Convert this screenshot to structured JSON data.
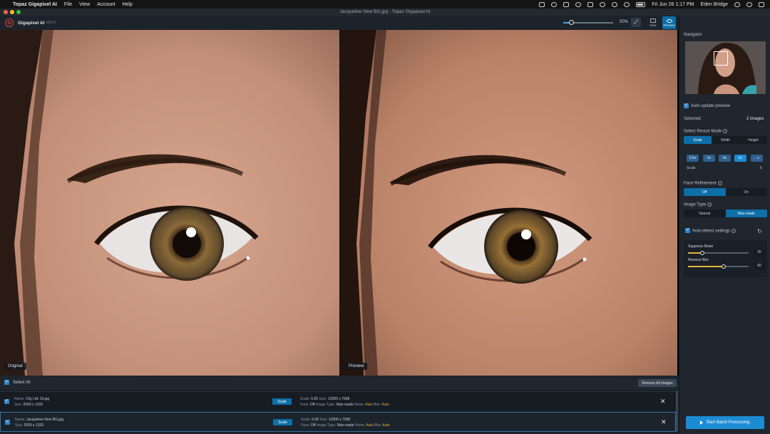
{
  "menubar": {
    "app": "Topaz Gigapixel AI",
    "items": [
      "File",
      "View",
      "Account",
      "Help"
    ],
    "datetime": "Fri Jun 26  1:17 PM",
    "user": "Eden Bridge"
  },
  "window": {
    "title": "Jacqueline New BG.jpg - Topaz Gigapixel AI"
  },
  "toolbar": {
    "app_name": "Gigapixel AI",
    "version": "v5.0.0",
    "zoom": "50%",
    "view_label": "View",
    "preview_label": "Preview"
  },
  "panes": {
    "original_label": "Original",
    "preview_label": "Preview"
  },
  "sidebar": {
    "navigator": "Navigator",
    "auto_update": "Auto-update preview",
    "selected_label": "Selected:",
    "selected_value": "2 images",
    "resize_mode_title": "Select Resize Mode",
    "resize_modes": [
      "Scale",
      "Width",
      "Height"
    ],
    "scale_options": [
      "0.5x",
      "2x",
      "4x",
      "6x",
      "...x"
    ],
    "scale_label": "Scale",
    "scale_value": "6",
    "face_title": "Face Refinement",
    "face_options": [
      "Off",
      "On"
    ],
    "image_type_title": "Image Type",
    "image_type_options": [
      "Natural",
      "Man-made"
    ],
    "auto_detect": "Auto-detect settings",
    "suppress_noise_label": "Suppress Noise",
    "suppress_noise_value": "20",
    "remove_blur_label": "Remove Blur",
    "remove_blur_value": "60",
    "batch_button": "Start Batch Processing"
  },
  "filelist": {
    "select_all": "Select All",
    "remove_all": "Remove All Images",
    "files": [
      {
        "name_label": "Name:",
        "name": "City Life 19.jpg",
        "size_label": "Size:",
        "size": "2000 x 1333",
        "scale_btn": "Scale",
        "scale_label": "Scale:",
        "scale": "6.00",
        "outsize_label": "Size:",
        "outsize": "12000 x 7998",
        "face_label": "Face:",
        "face": "Off",
        "type_label": "Image Type:",
        "type": "Man-made",
        "noise_label": "Noise:",
        "noise": "Auto",
        "blur_label": "Blur:",
        "blur": "Auto"
      },
      {
        "name_label": "Name:",
        "name": "Jacqueline New BG.jpg",
        "size_label": "Size:",
        "size": "2000 x 1333",
        "scale_btn": "Scale",
        "scale_label": "Scale:",
        "scale": "6.00",
        "outsize_label": "Size:",
        "outsize": "12000 x 7998",
        "face_label": "Face:",
        "face": "Off",
        "type_label": "Image Type:",
        "type": "Man-made",
        "noise_label": "Noise:",
        "noise": "Auto",
        "blur_label": "Blur:",
        "blur": "Auto"
      }
    ]
  },
  "colors": {
    "accent": "#1d8bd4",
    "active_segment": "#0e6ea8",
    "auto_value": "#e0b43a",
    "panel": "#1f262e"
  }
}
